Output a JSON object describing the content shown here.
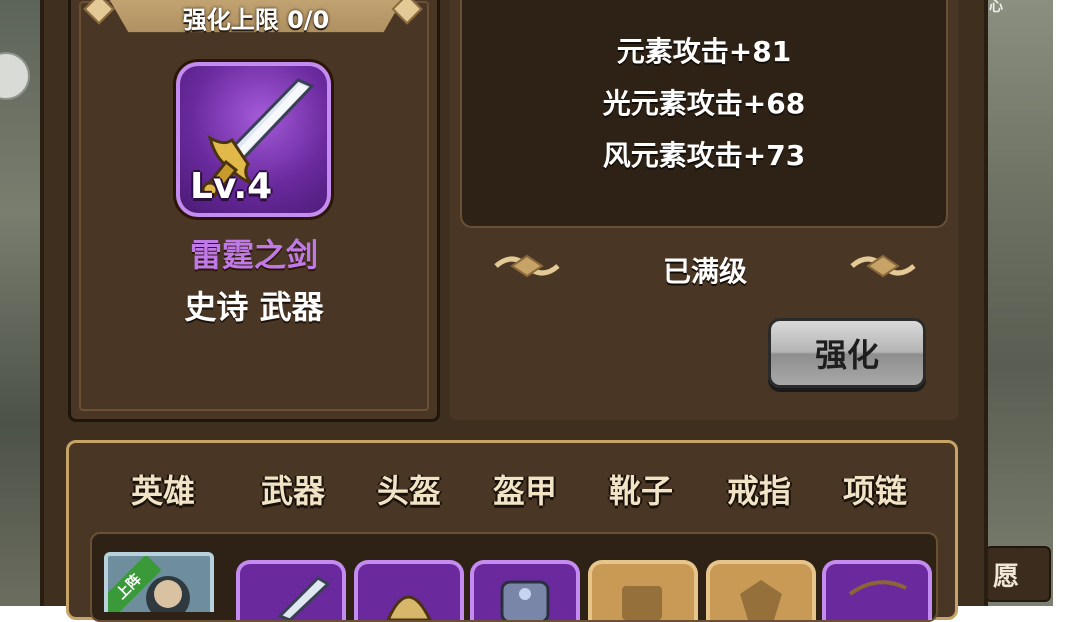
{
  "panel": {
    "enhance_cap": "强化上限 0/0"
  },
  "item": {
    "level": "Lv.4",
    "name": "雷霆之剑",
    "type": "史诗 武器",
    "icon": "sword-icon"
  },
  "stats": [
    "元素攻击+81",
    "光元素攻击+68",
    "风元素攻击+73"
  ],
  "status": {
    "maxed": "已满级"
  },
  "upgrade_button": {
    "label": "强化"
  },
  "tabs": [
    "英雄",
    "武器",
    "头盔",
    "盔甲",
    "靴子",
    "戒指",
    "项链"
  ],
  "slots": {
    "hero_tag": "上阵",
    "icons": [
      "hero-portrait-icon",
      "sword-icon",
      "helmet-icon",
      "armor-icon",
      "boots-icon",
      "ring-icon",
      "necklace-icon"
    ]
  },
  "side": {
    "wish_button": "愿",
    "corner_char": "心"
  },
  "colors": {
    "epic_purple": "#c07ae8",
    "panel_brown": "#4a3624",
    "gold_border": "#c8a368"
  }
}
